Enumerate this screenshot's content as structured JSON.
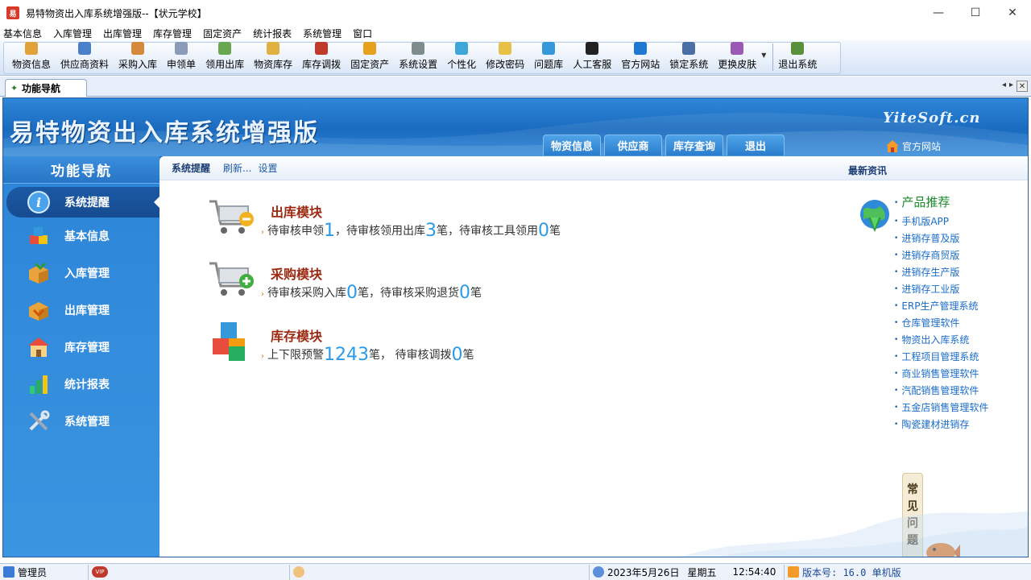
{
  "window": {
    "icon_text": "易",
    "title": "易特物资出入库系统增强版--【状元学校】",
    "controls": {
      "minimize": "—",
      "maximize": "☐",
      "close": "✕"
    }
  },
  "menu": [
    "基本信息",
    "入库管理",
    "出库管理",
    "库存管理",
    "固定资产",
    "统计报表",
    "系统管理",
    "窗口"
  ],
  "toolbar": [
    {
      "label": "物资信息",
      "color": "#e2a23a"
    },
    {
      "label": "供应商资料",
      "color": "#4a7fc9"
    },
    {
      "label": "采购入库",
      "color": "#d48a3a"
    },
    {
      "label": "申领单",
      "color": "#8b9bb8"
    },
    {
      "label": "领用出库",
      "color": "#6aa84f"
    },
    {
      "label": "物资库存",
      "color": "#e0b040"
    },
    {
      "label": "库存调拨",
      "color": "#c0392b"
    },
    {
      "label": "固定资产",
      "color": "#e6a019"
    },
    {
      "label": "系统设置",
      "color": "#7f8c8d"
    },
    {
      "label": "个性化",
      "color": "#3fa6d8"
    },
    {
      "label": "修改密码",
      "color": "#e8c048"
    },
    {
      "label": "问题库",
      "color": "#3498db"
    },
    {
      "label": "人工客服",
      "color": "#222222"
    },
    {
      "label": "官方网站",
      "color": "#1e78d2"
    },
    {
      "label": "锁定系统",
      "color": "#4a6fa5"
    },
    {
      "label": "更换皮肤",
      "color": "#9b59b6"
    },
    {
      "label": "退出系统",
      "color": "#5a8f3c"
    }
  ],
  "tab": {
    "label": "功能导航"
  },
  "banner": {
    "title": "易特物资出入库系统增强版",
    "brand": "YiteSoft.cn",
    "tabs": [
      "物资信息",
      "供应商",
      "库存查询",
      "退出"
    ],
    "site_link": "官方网站"
  },
  "sidebar": {
    "title": "功能导航",
    "items": [
      {
        "label": "系统提醒",
        "active": true
      },
      {
        "label": "基本信息",
        "active": false
      },
      {
        "label": "入库管理",
        "active": false
      },
      {
        "label": "出库管理",
        "active": false
      },
      {
        "label": "库存管理",
        "active": false
      },
      {
        "label": "统计报表",
        "active": false
      },
      {
        "label": "系统管理",
        "active": false
      }
    ]
  },
  "content": {
    "header_title": "系统提醒",
    "refresh": "刷新...",
    "settings": "设置",
    "news_title": "最新资讯",
    "modules": [
      {
        "title": "出库模块",
        "parts": [
          {
            "t": "待审核申领"
          },
          {
            "n": "1"
          },
          {
            "t": "，待审核领用出库"
          },
          {
            "n": "3"
          },
          {
            "t": "笔，待审核工具领用"
          },
          {
            "n": "0"
          },
          {
            "t": "笔"
          }
        ]
      },
      {
        "title": "采购模块",
        "parts": [
          {
            "t": "待审核采购入库"
          },
          {
            "n": "0"
          },
          {
            "t": "笔，待审核采购退货"
          },
          {
            "n": "0"
          },
          {
            "t": "笔"
          }
        ]
      },
      {
        "title": "库存模块",
        "parts": [
          {
            "t": "上下限预警"
          },
          {
            "n": "1243"
          },
          {
            "t": "笔， 待审核调拨"
          },
          {
            "n": "0"
          },
          {
            "t": "笔"
          }
        ]
      }
    ],
    "news": {
      "heading": "产品推荐",
      "items": [
        "手机版APP",
        "进销存普及版",
        "进销存商贸版",
        "进销存生产版",
        "进销存工业版",
        "ERP生产管理系统",
        "仓库管理软件",
        "物资出入库系统",
        "工程项目管理系统",
        "商业销售管理软件",
        "汽配销售管理软件",
        "五金店销售管理软件",
        "陶瓷建材进销存"
      ]
    },
    "faq": [
      "常",
      "见",
      "问",
      "题"
    ]
  },
  "statusbar": {
    "user": "管理员",
    "vip": "VIP",
    "date": "2023年5月26日",
    "weekday": "星期五",
    "time": "12:54:40",
    "version": "版本号: 16.0 单机版"
  },
  "colors": {
    "sidebar": "#2c84d8",
    "banner": "#1a6bc0",
    "module_title": "#9b2a12",
    "number": "#2b9be8",
    "link": "#1a6cc8",
    "news_heading": "#1a8a2a"
  }
}
